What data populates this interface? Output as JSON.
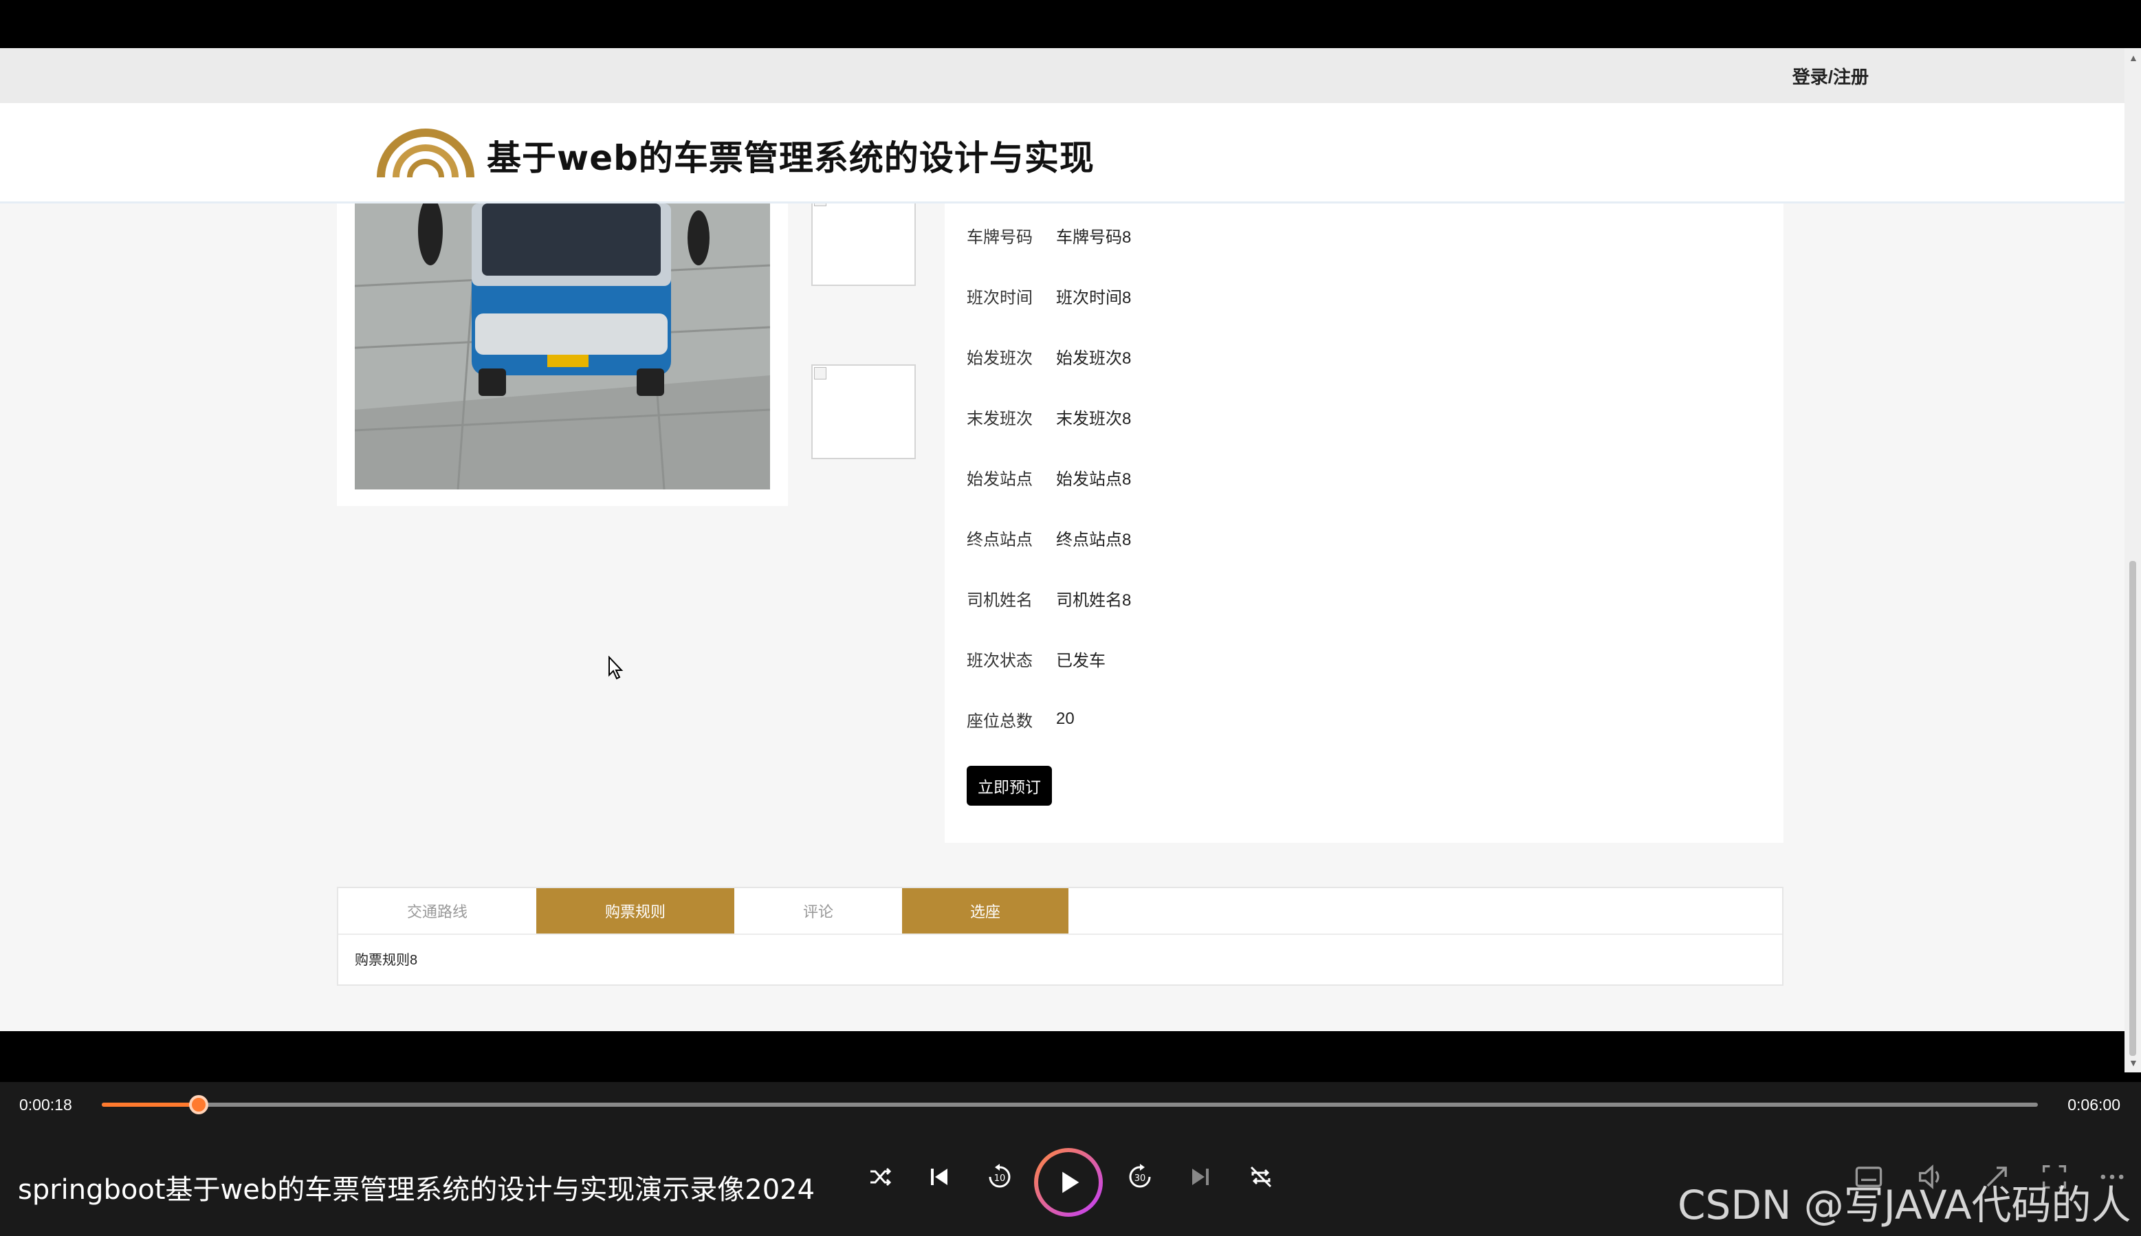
{
  "topbar": {
    "login_label": "登录/注册"
  },
  "header": {
    "site_title": "基于web的车票管理系统的设计与实现"
  },
  "detail": {
    "rows": [
      {
        "label": "车牌号码",
        "value": "车牌号码8"
      },
      {
        "label": "班次时间",
        "value": "班次时间8"
      },
      {
        "label": "始发班次",
        "value": "始发班次8"
      },
      {
        "label": "末发班次",
        "value": "末发班次8"
      },
      {
        "label": "始发站点",
        "value": "始发站点8"
      },
      {
        "label": "终点站点",
        "value": "终点站点8"
      },
      {
        "label": "司机姓名",
        "value": "司机姓名8"
      },
      {
        "label": "班次状态",
        "value": "已发车"
      },
      {
        "label": "座位总数",
        "value": "20"
      }
    ],
    "book_button": "立即预订"
  },
  "tabs": {
    "items": [
      {
        "label": "交通路线",
        "active": false
      },
      {
        "label": "购票规则",
        "active": true
      },
      {
        "label": "评论",
        "active": false
      },
      {
        "label": "选座",
        "active": true
      }
    ],
    "content": "购票规则8"
  },
  "player": {
    "current_time": "0:00:18",
    "total_time": "0:06:00",
    "progress": 0.05,
    "title": "springboot基于web的车票管理系统的设计与实现演示录像2024",
    "watermark": "CSDN @写JAVA代码的人",
    "accent_color": "#ff7a2e",
    "controls": [
      "shuffle-icon",
      "previous-icon",
      "rewind-10-icon",
      "play-icon",
      "forward-30-icon",
      "next-icon",
      "repeat-icon"
    ]
  },
  "colors": {
    "brand": "#b78a34",
    "header_bg": "#ffffff",
    "page_bg": "#f6f6f6"
  }
}
